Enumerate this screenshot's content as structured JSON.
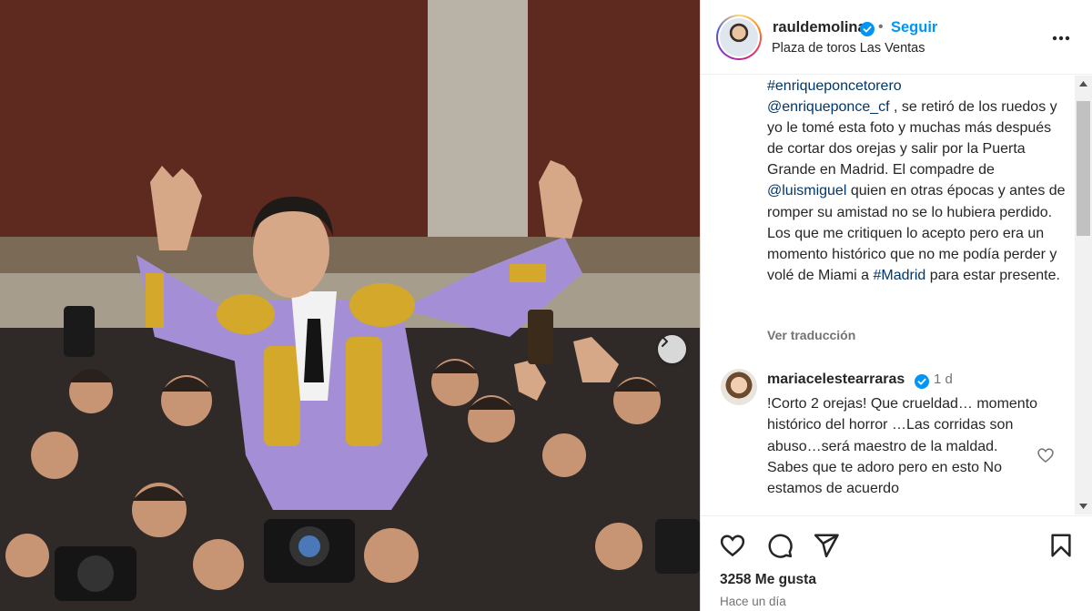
{
  "post": {
    "username": "rauldemolina",
    "follow_label": "Seguir",
    "separator": "•",
    "location": "Plaza de toros Las Ventas",
    "caption": {
      "hashtag_top": "#enriqueponcetorero",
      "mention_1": "@enriqueponce_cf",
      "text_1": " , se retiró de los ruedos y yo le tomé esta foto y muchas más después de cortar dos orejas y salir por la Puerta Grande en Madrid. El compadre de ",
      "mention_2": "@luismiguel",
      "text_2": " quien en otras épocas y antes de romper su amistad no se lo hubiera perdido.",
      "text_3": "Los que me critiquen lo acepto pero era un momento histórico que no me podía perder y volé de Miami a ",
      "hashtag_2": "#Madrid",
      "text_4": " para estar presente."
    },
    "translate_label": "Ver traducción",
    "likes": "3258 Me gusta",
    "time_ago": "Hace un día"
  },
  "comment": {
    "username": "mariacelestearraras",
    "time": "1 d",
    "line_1": "!Corto 2 orejas! Que crueldad… momento histórico del horror …Las corridas son abuso…será maestro de la maldad.",
    "line_2": "Sabes que te adoro pero en esto No estamos de acuerdo"
  },
  "icons": {
    "verified": "verified-badge-icon",
    "more": "more-options-icon",
    "like": "heart-icon",
    "comment": "comment-icon",
    "share": "send-icon",
    "save": "bookmark-icon",
    "next": "chevron-right-icon"
  },
  "colors": {
    "accent": "#0095f6",
    "link": "#00376b",
    "muted": "#737373"
  }
}
